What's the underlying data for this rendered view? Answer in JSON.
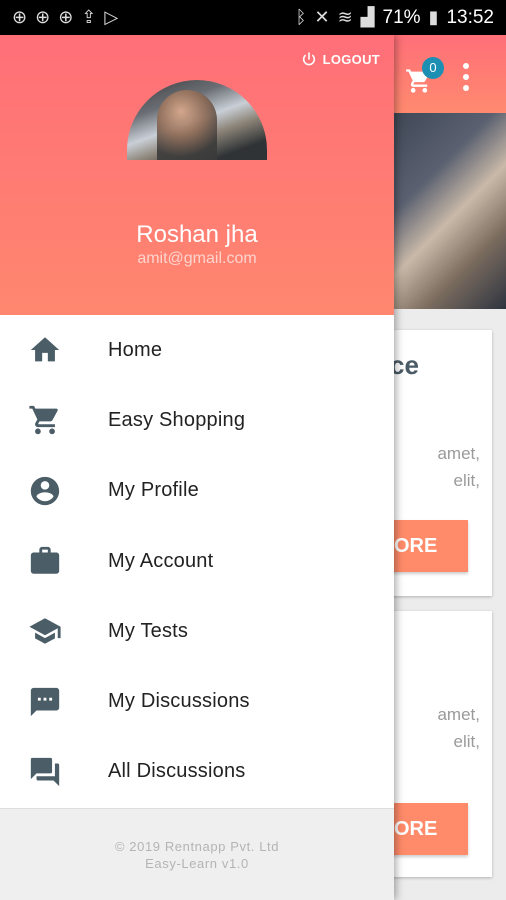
{
  "status_bar": {
    "battery": "71%",
    "time": "13:52"
  },
  "app": {
    "cart_count": "0",
    "card1": {
      "title": "ce",
      "text_line1": "amet,",
      "text_line2": "elit,",
      "button": "ORE"
    },
    "card2": {
      "text_line1": "amet,",
      "text_line2": "elit,",
      "button": "ORE"
    }
  },
  "drawer": {
    "logout_label": "LOGOUT",
    "user_name": "Roshan jha",
    "user_email": "amit@gmail.com",
    "menu": [
      {
        "label": "Home",
        "icon": "home-icon"
      },
      {
        "label": "Easy Shopping",
        "icon": "cart-icon"
      },
      {
        "label": "My Profile",
        "icon": "account-circle-icon"
      },
      {
        "label": "My Account",
        "icon": "briefcase-icon"
      },
      {
        "label": "My Tests",
        "icon": "graduation-cap-icon"
      },
      {
        "label": "My Discussions",
        "icon": "chat-bubble-icon"
      },
      {
        "label": "All Discussions",
        "icon": "forum-icon"
      }
    ],
    "footer": {
      "copyright": "© 2019 Rentnapp Pvt. Ltd",
      "version": "Easy-Learn v1.0"
    }
  },
  "colors": {
    "header_top": "#ff6f78",
    "header_bottom": "#ff876f",
    "icon": "#4b5d67",
    "badge": "#1d8fb3",
    "button": "#ff8b6a"
  }
}
